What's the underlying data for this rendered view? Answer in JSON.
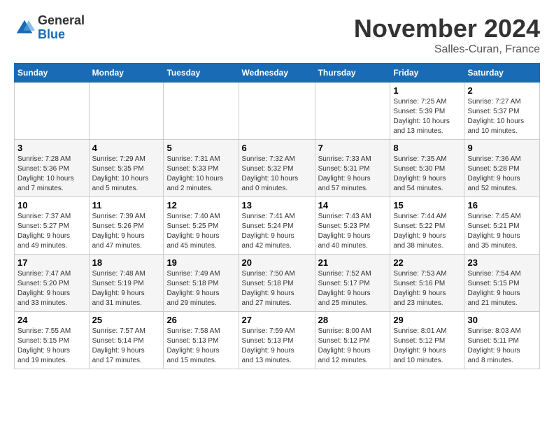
{
  "logo": {
    "general": "General",
    "blue": "Blue"
  },
  "title": "November 2024",
  "location": "Salles-Curan, France",
  "days_of_week": [
    "Sunday",
    "Monday",
    "Tuesday",
    "Wednesday",
    "Thursday",
    "Friday",
    "Saturday"
  ],
  "weeks": [
    [
      {
        "day": "",
        "info": ""
      },
      {
        "day": "",
        "info": ""
      },
      {
        "day": "",
        "info": ""
      },
      {
        "day": "",
        "info": ""
      },
      {
        "day": "",
        "info": ""
      },
      {
        "day": "1",
        "info": "Sunrise: 7:25 AM\nSunset: 5:39 PM\nDaylight: 10 hours\nand 13 minutes."
      },
      {
        "day": "2",
        "info": "Sunrise: 7:27 AM\nSunset: 5:37 PM\nDaylight: 10 hours\nand 10 minutes."
      }
    ],
    [
      {
        "day": "3",
        "info": "Sunrise: 7:28 AM\nSunset: 5:36 PM\nDaylight: 10 hours\nand 7 minutes."
      },
      {
        "day": "4",
        "info": "Sunrise: 7:29 AM\nSunset: 5:35 PM\nDaylight: 10 hours\nand 5 minutes."
      },
      {
        "day": "5",
        "info": "Sunrise: 7:31 AM\nSunset: 5:33 PM\nDaylight: 10 hours\nand 2 minutes."
      },
      {
        "day": "6",
        "info": "Sunrise: 7:32 AM\nSunset: 5:32 PM\nDaylight: 10 hours\nand 0 minutes."
      },
      {
        "day": "7",
        "info": "Sunrise: 7:33 AM\nSunset: 5:31 PM\nDaylight: 9 hours\nand 57 minutes."
      },
      {
        "day": "8",
        "info": "Sunrise: 7:35 AM\nSunset: 5:30 PM\nDaylight: 9 hours\nand 54 minutes."
      },
      {
        "day": "9",
        "info": "Sunrise: 7:36 AM\nSunset: 5:28 PM\nDaylight: 9 hours\nand 52 minutes."
      }
    ],
    [
      {
        "day": "10",
        "info": "Sunrise: 7:37 AM\nSunset: 5:27 PM\nDaylight: 9 hours\nand 49 minutes."
      },
      {
        "day": "11",
        "info": "Sunrise: 7:39 AM\nSunset: 5:26 PM\nDaylight: 9 hours\nand 47 minutes."
      },
      {
        "day": "12",
        "info": "Sunrise: 7:40 AM\nSunset: 5:25 PM\nDaylight: 9 hours\nand 45 minutes."
      },
      {
        "day": "13",
        "info": "Sunrise: 7:41 AM\nSunset: 5:24 PM\nDaylight: 9 hours\nand 42 minutes."
      },
      {
        "day": "14",
        "info": "Sunrise: 7:43 AM\nSunset: 5:23 PM\nDaylight: 9 hours\nand 40 minutes."
      },
      {
        "day": "15",
        "info": "Sunrise: 7:44 AM\nSunset: 5:22 PM\nDaylight: 9 hours\nand 38 minutes."
      },
      {
        "day": "16",
        "info": "Sunrise: 7:45 AM\nSunset: 5:21 PM\nDaylight: 9 hours\nand 35 minutes."
      }
    ],
    [
      {
        "day": "17",
        "info": "Sunrise: 7:47 AM\nSunset: 5:20 PM\nDaylight: 9 hours\nand 33 minutes."
      },
      {
        "day": "18",
        "info": "Sunrise: 7:48 AM\nSunset: 5:19 PM\nDaylight: 9 hours\nand 31 minutes."
      },
      {
        "day": "19",
        "info": "Sunrise: 7:49 AM\nSunset: 5:18 PM\nDaylight: 9 hours\nand 29 minutes."
      },
      {
        "day": "20",
        "info": "Sunrise: 7:50 AM\nSunset: 5:18 PM\nDaylight: 9 hours\nand 27 minutes."
      },
      {
        "day": "21",
        "info": "Sunrise: 7:52 AM\nSunset: 5:17 PM\nDaylight: 9 hours\nand 25 minutes."
      },
      {
        "day": "22",
        "info": "Sunrise: 7:53 AM\nSunset: 5:16 PM\nDaylight: 9 hours\nand 23 minutes."
      },
      {
        "day": "23",
        "info": "Sunrise: 7:54 AM\nSunset: 5:15 PM\nDaylight: 9 hours\nand 21 minutes."
      }
    ],
    [
      {
        "day": "24",
        "info": "Sunrise: 7:55 AM\nSunset: 5:15 PM\nDaylight: 9 hours\nand 19 minutes."
      },
      {
        "day": "25",
        "info": "Sunrise: 7:57 AM\nSunset: 5:14 PM\nDaylight: 9 hours\nand 17 minutes."
      },
      {
        "day": "26",
        "info": "Sunrise: 7:58 AM\nSunset: 5:13 PM\nDaylight: 9 hours\nand 15 minutes."
      },
      {
        "day": "27",
        "info": "Sunrise: 7:59 AM\nSunset: 5:13 PM\nDaylight: 9 hours\nand 13 minutes."
      },
      {
        "day": "28",
        "info": "Sunrise: 8:00 AM\nSunset: 5:12 PM\nDaylight: 9 hours\nand 12 minutes."
      },
      {
        "day": "29",
        "info": "Sunrise: 8:01 AM\nSunset: 5:12 PM\nDaylight: 9 hours\nand 10 minutes."
      },
      {
        "day": "30",
        "info": "Sunrise: 8:03 AM\nSunset: 5:11 PM\nDaylight: 9 hours\nand 8 minutes."
      }
    ]
  ]
}
